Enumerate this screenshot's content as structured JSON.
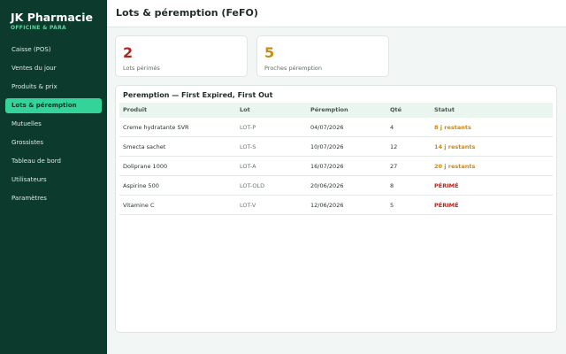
{
  "sidebar": {
    "brand": "JK Pharmacie",
    "subtitle": "OFFICINE & PARA",
    "items": [
      {
        "label": "Caisse (POS)",
        "active": false
      },
      {
        "label": "Ventes du jour",
        "active": false
      },
      {
        "label": "Produits & prix",
        "active": false
      },
      {
        "label": "Lots & péremption",
        "active": true
      },
      {
        "label": "Mutuelles",
        "active": false
      },
      {
        "label": "Grossistes",
        "active": false
      },
      {
        "label": "Tableau de bord",
        "active": false
      },
      {
        "label": "Utilisateurs",
        "active": false
      },
      {
        "label": "Paramètres",
        "active": false
      }
    ]
  },
  "header": {
    "title": "Lots & péremption (FeFO)"
  },
  "stats": [
    {
      "value": "2",
      "label": "Lots périmés",
      "color": "#b3261e"
    },
    {
      "value": "5",
      "label": "Proches péremption",
      "color": "#c98a16"
    }
  ],
  "panel": {
    "title": "Peremption — First Expired, First Out",
    "columns": [
      "Produit",
      "Lot",
      "Péremption",
      "Qté",
      "Statut"
    ],
    "rows": [
      {
        "product": "Creme hydratante SVR",
        "lot": "LOT-P",
        "expiry": "04/07/2026",
        "qty": "4",
        "status": "8 j restants",
        "status_color": "#c98a16"
      },
      {
        "product": "Smecta sachet",
        "lot": "LOT-S",
        "expiry": "10/07/2026",
        "qty": "12",
        "status": "14 j restants",
        "status_color": "#c98a16"
      },
      {
        "product": "Doliprane 1000",
        "lot": "LOT-A",
        "expiry": "16/07/2026",
        "qty": "27",
        "status": "20 j restants",
        "status_color": "#c98a16"
      },
      {
        "product": "Aspirine 500",
        "lot": "LOT-OLD",
        "expiry": "20/06/2026",
        "qty": "8",
        "status": "PÉRIMÉ",
        "status_color": "#b3261e"
      },
      {
        "product": "Vitamine C",
        "lot": "LOT-V",
        "expiry": "12/06/2026",
        "qty": "5",
        "status": "PÉRIMÉ",
        "status_color": "#b3261e"
      }
    ]
  }
}
